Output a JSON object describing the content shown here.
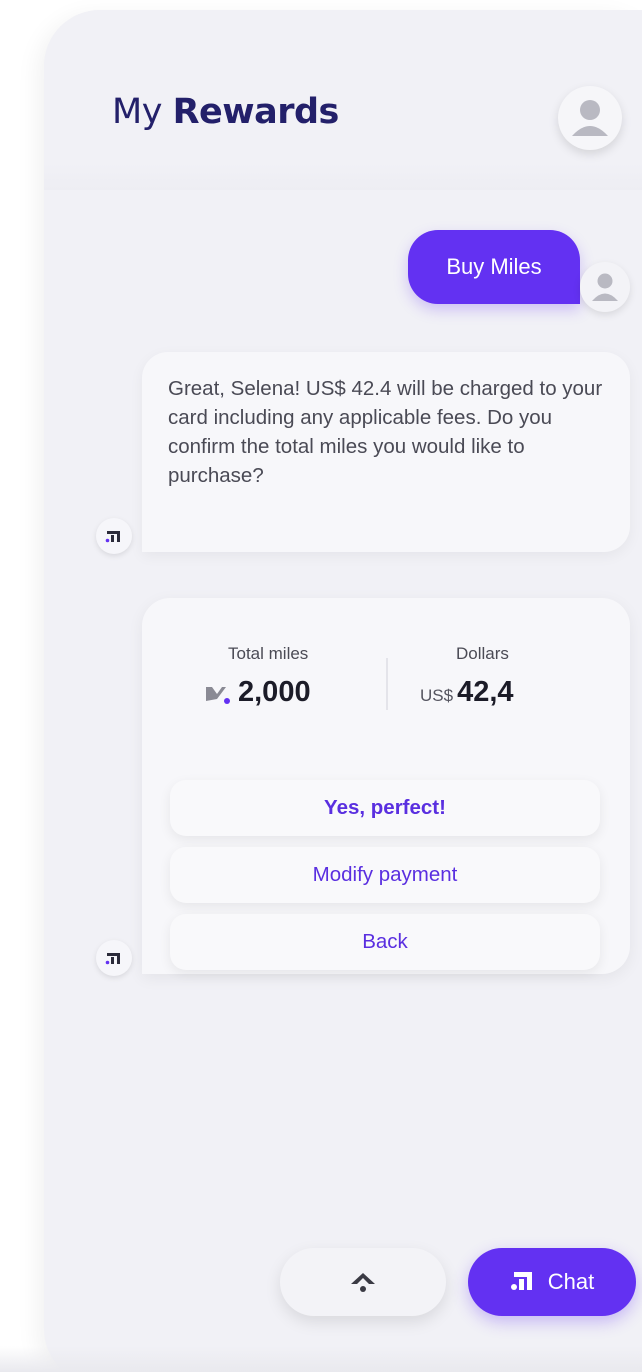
{
  "header": {
    "title_prefix": "My",
    "title_bold": "Rewards",
    "avatar_icon": "user-avatar-icon"
  },
  "conversation": {
    "user_message": "Buy Miles",
    "bot_message": "Great, Selena! US$ 42.4 will be charged to your card including any applicable fees. Do you confirm the total miles you would like to purchase?"
  },
  "summary": {
    "miles_label": "Total miles",
    "miles_value": "2,000",
    "dollars_label": "Dollars",
    "dollars_currency": "US$",
    "dollars_value": "42,4"
  },
  "options": [
    {
      "label": "Yes, perfect!"
    },
    {
      "label": "Modify payment"
    },
    {
      "label": "Back"
    }
  ],
  "bottom_bar": {
    "chat_label": "Chat"
  },
  "colors": {
    "accent": "#6331f2",
    "title": "#23206a",
    "background": "#f1f1f6"
  }
}
